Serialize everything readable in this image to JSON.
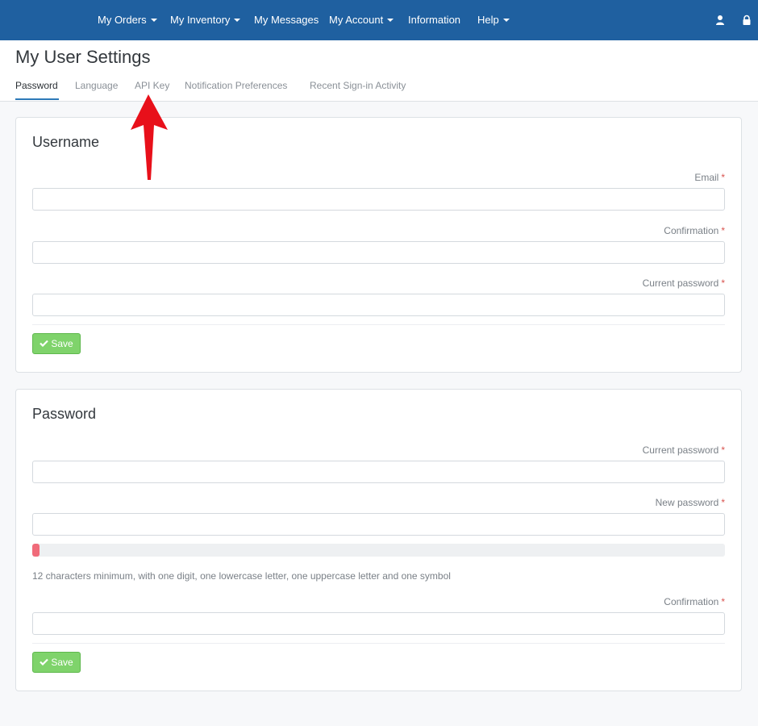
{
  "navbar": {
    "items": [
      {
        "label": "My Orders",
        "dropdown": true
      },
      {
        "label": "My Inventory",
        "dropdown": true
      },
      {
        "label": "My Messages",
        "dropdown": false
      },
      {
        "label": "My Account",
        "dropdown": true
      },
      {
        "label": "Information",
        "dropdown": false
      },
      {
        "label": "Help",
        "dropdown": true
      }
    ],
    "icons": [
      "user-icon",
      "lock-icon"
    ],
    "background": "#1f60a0"
  },
  "page": {
    "title": "My User Settings",
    "tabs": [
      {
        "label": "Password",
        "active": true
      },
      {
        "label": "Language",
        "active": false
      },
      {
        "label": "API Key",
        "active": false
      },
      {
        "label": "Notification Preferences",
        "active": false
      },
      {
        "label": "Recent Sign-in Activity",
        "active": false
      }
    ]
  },
  "username_section": {
    "title": "Username",
    "fields": [
      {
        "label": "Email",
        "required": "*",
        "value": ""
      },
      {
        "label": "Confirmation",
        "required": "*",
        "value": ""
      },
      {
        "label": "Current password",
        "required": "*",
        "value": ""
      }
    ],
    "save_label": "Save"
  },
  "password_section": {
    "title": "Password",
    "current_password": {
      "label": "Current password",
      "required": "*",
      "value": ""
    },
    "new_password": {
      "label": "New password",
      "required": "*",
      "value": ""
    },
    "strength_level": 0.01,
    "strength_color": "#f06b7a",
    "help_text": "12 characters minimum, with one digit, one lowercase letter, one uppercase letter and one symbol",
    "confirmation": {
      "label": "Confirmation",
      "required": "*",
      "value": ""
    },
    "save_label": "Save"
  },
  "colors": {
    "accent": "#2d79b8",
    "save_button": "#7fd36b",
    "required": "#d9534f",
    "annotation_arrow": "#e8101a"
  }
}
